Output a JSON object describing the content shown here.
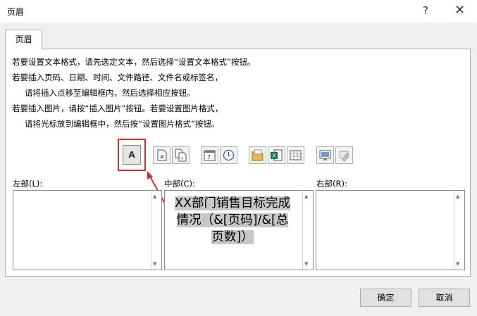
{
  "window": {
    "title": "页眉",
    "help_icon": "?",
    "close_icon": "✕"
  },
  "tab": {
    "label": "页眉"
  },
  "instructions": [
    "若要设置文本格式，请先选定文本，然后选择“设置文本格式”按钮。",
    "若要插入页码、日期、时间、文件路径、文件名或标签名，",
    "请将插入点移至编辑框内，然后选择相应按钮。",
    "若要插入图片，请按“插入图片”按钮。若要设置图片格式，",
    "请将光标放到编辑框中，然后按“设置图片格式”按钮。"
  ],
  "toolbar": [
    {
      "name": "format-text-button",
      "glyph": "A"
    },
    {
      "name": "insert-page-number-button",
      "icon": "page-number-icon"
    },
    {
      "name": "insert-page-count-button",
      "icon": "page-count-icon"
    },
    {
      "name": "insert-date-button",
      "icon": "calendar-icon"
    },
    {
      "name": "insert-time-button",
      "icon": "clock-icon"
    },
    {
      "name": "insert-file-path-button",
      "icon": "folder-icon"
    },
    {
      "name": "insert-file-name-button",
      "icon": "excel-file-icon"
    },
    {
      "name": "insert-sheet-name-button",
      "icon": "sheet-icon"
    },
    {
      "name": "insert-picture-button",
      "icon": "picture-icon"
    },
    {
      "name": "format-picture-button",
      "icon": "format-picture-icon"
    }
  ],
  "sections": {
    "left": {
      "label": "左部(L):",
      "value": ""
    },
    "center": {
      "label": "中部(C):",
      "lines": [
        "XX部门销售目标完成",
        "情况（&[页码]/&[总",
        "页数]）"
      ]
    },
    "right": {
      "label": "右部(R):",
      "value": ""
    }
  },
  "buttons": {
    "ok": "确定",
    "cancel": "取消"
  },
  "colors": {
    "highlight_box": "#d62d2d",
    "arrow": "#d62d2d",
    "selection": "#c8c8c8"
  }
}
